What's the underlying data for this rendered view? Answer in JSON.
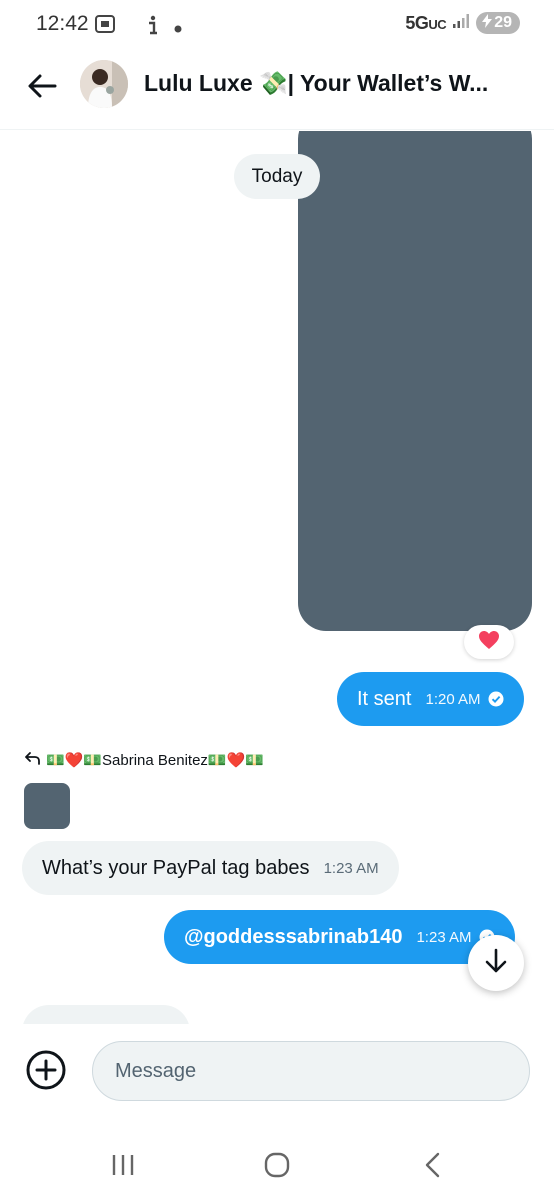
{
  "status_bar": {
    "time": "12:42",
    "network": "5G",
    "network_sub": "UC",
    "battery": "29"
  },
  "header": {
    "title": "Lulu Luxe 💸| Your Wallet’s W...",
    "back_icon": "arrow-left-icon",
    "avatar_icon": "avatar"
  },
  "chat": {
    "date_label": "Today",
    "reaction": "❤️",
    "messages": [
      {
        "direction": "out",
        "text": "It sent",
        "time": "1:20 AM"
      },
      {
        "direction": "in",
        "text": "What’s your PayPal tag babes",
        "time": "1:23 AM"
      },
      {
        "direction": "out",
        "text": "@goddesssabrinab140",
        "time": "1:23 AM"
      }
    ],
    "reply_to": "💵❤️💵Sabrina Benitez💵❤️💵"
  },
  "composer": {
    "placeholder": "Message"
  },
  "colors": {
    "accent": "#1d9bf0",
    "incoming_bubble": "#eff3f4",
    "media_placeholder": "#536471"
  }
}
